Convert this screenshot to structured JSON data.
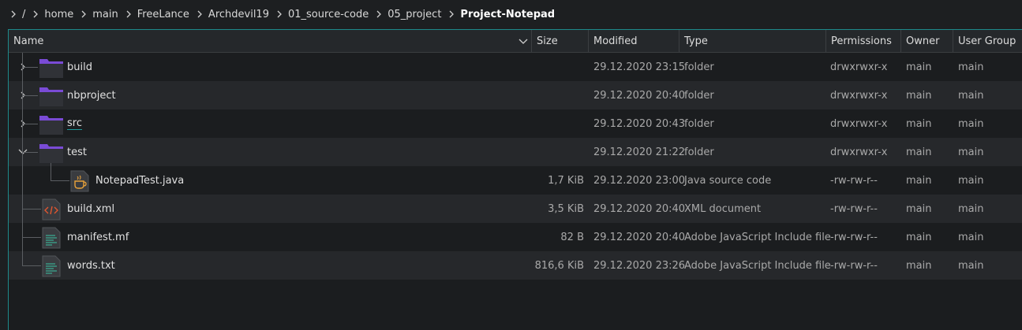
{
  "breadcrumb": {
    "items": [
      "/",
      "home",
      "main",
      "FreeLance",
      "Archdevil19",
      "01_source-code",
      "05_project",
      "Project-Notepad"
    ]
  },
  "columns": {
    "name": "Name",
    "size": "Size",
    "modified": "Modified",
    "type": "Type",
    "permissions": "Permissions",
    "owner": "Owner",
    "group": "User Group"
  },
  "rows": [
    {
      "name": "build",
      "size": "",
      "modified": "29.12.2020 23:15",
      "type": "folder",
      "permissions": "drwxrwxr-x",
      "owner": "main",
      "group": "main",
      "icon": "folder-icon",
      "expanded": false
    },
    {
      "name": "nbproject",
      "size": "",
      "modified": "29.12.2020 20:40",
      "type": "folder",
      "permissions": "drwxrwxr-x",
      "owner": "main",
      "group": "main",
      "icon": "folder-icon",
      "expanded": false
    },
    {
      "name": "src",
      "size": "",
      "modified": "29.12.2020 20:43",
      "type": "folder",
      "permissions": "drwxrwxr-x",
      "owner": "main",
      "group": "main",
      "icon": "folder-icon",
      "expanded": false
    },
    {
      "name": "test",
      "size": "",
      "modified": "29.12.2020 21:22",
      "type": "folder",
      "permissions": "drwxrwxr-x",
      "owner": "main",
      "group": "main",
      "icon": "folder-icon",
      "expanded": true
    },
    {
      "name": "NotepadTest.java",
      "size": "1,7 KiB",
      "modified": "29.12.2020 23:00",
      "type": "Java source code",
      "permissions": "-rw-rw-r--",
      "owner": "main",
      "group": "main",
      "icon": "java-file-icon"
    },
    {
      "name": "build.xml",
      "size": "3,5 KiB",
      "modified": "29.12.2020 20:40",
      "type": "XML document",
      "permissions": "-rw-rw-r--",
      "owner": "main",
      "group": "main",
      "icon": "xml-file-icon"
    },
    {
      "name": "manifest.mf",
      "size": "82 B",
      "modified": "29.12.2020 20:40",
      "type": "Adobe JavaScript Include file",
      "permissions": "-rw-rw-r--",
      "owner": "main",
      "group": "main",
      "icon": "text-file-icon"
    },
    {
      "name": "words.txt",
      "size": "816,6 KiB",
      "modified": "29.12.2020 23:26",
      "type": "Adobe JavaScript Include file",
      "permissions": "-rw-rw-r--",
      "owner": "main",
      "group": "main",
      "icon": "text-file-icon"
    }
  ],
  "colors": {
    "background": "#1b1d1f",
    "accent": "#1e8a8a",
    "folder": "#7a4bd6"
  }
}
